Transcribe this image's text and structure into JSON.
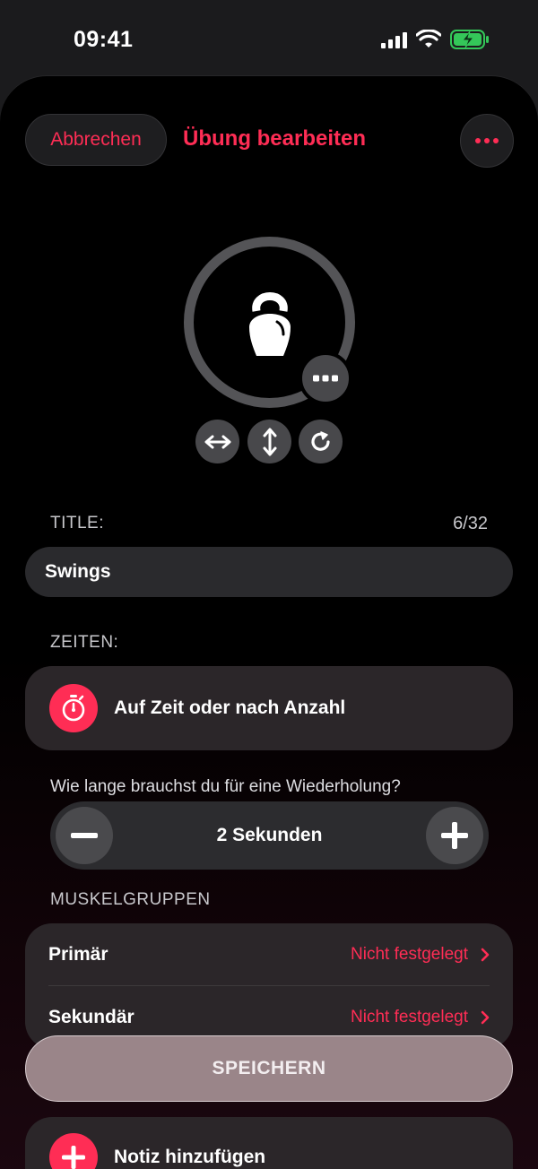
{
  "status_bar": {
    "time": "09:41"
  },
  "nav": {
    "cancel_label": "Abbrechen",
    "title": "Übung bearbeiten"
  },
  "exercise_icon": {
    "icon": "kettlebell-icon"
  },
  "title_section": {
    "label": "TITLE:",
    "counter": "6/32",
    "value": "Swings"
  },
  "times_section": {
    "label": "ZEITEN:",
    "mode_label": "Auf Zeit oder nach Anzahl",
    "question": "Wie lange brauchst du für eine Wiederholung?",
    "stepper_value": "2 Sekunden"
  },
  "muscle_section": {
    "label": "MUSKELGRUPPEN",
    "rows": [
      {
        "label": "Primär",
        "value": "Nicht festgelegt"
      },
      {
        "label": "Sekundär",
        "value": "Nicht festgelegt"
      }
    ]
  },
  "save_label": "SPEICHERN",
  "note_label": "Notiz hinzufügen",
  "colors": {
    "accent": "#ff2d55",
    "background": "#000000",
    "card": "#2b2629"
  }
}
